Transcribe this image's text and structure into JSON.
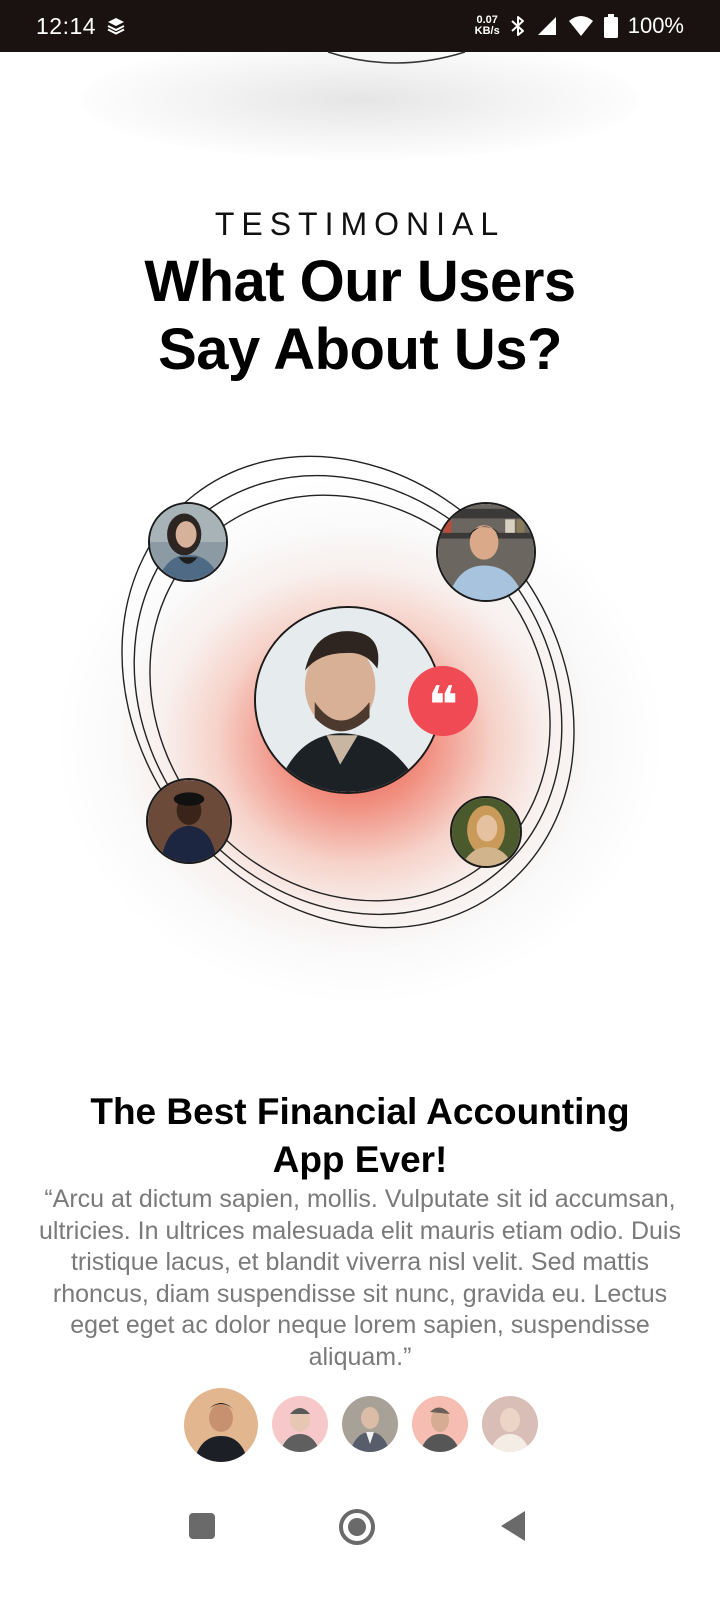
{
  "status_bar": {
    "time": "12:14",
    "net_speed_value": "0.07",
    "net_speed_unit": "KB/s",
    "battery": "100%",
    "icons": [
      "layers-icon",
      "bluetooth-icon",
      "signal-icon",
      "wifi-icon",
      "battery-icon"
    ]
  },
  "section": {
    "eyebrow": "TESTIMONIAL",
    "headline_line1": "What Our Users",
    "headline_line2": "Say About Us?"
  },
  "featured": {
    "quote_mark": "❝",
    "avatars": [
      "user-avatar-woman-denim",
      "user-avatar-man-bookshelf",
      "user-avatar-man-beret",
      "user-avatar-woman-blonde",
      "featured-user-man-beard"
    ]
  },
  "review": {
    "title_line1": "The Best Financial Accounting",
    "title_line2": "App Ever!",
    "text": "“Arcu at dictum sapien, mollis. Vulputate sit id accumsan, ultricies. In ultrices malesuada elit mauris etiam odio. Duis tristique lacus, et blandit viverra nisl velit. Sed mattis rhoncus, diam suspendisse sit nunc, gravida eu. Lectus eget eget ac dolor neque lorem sapien, suspendisse aliquam.”"
  },
  "thumbnails": {
    "active_index": 0,
    "count": 5
  },
  "colors": {
    "accent": "#f04a55",
    "status_bar_bg": "#1a1210",
    "body_text": "#7a7a7a"
  },
  "nav": {
    "icons": [
      "recents-square-icon",
      "home-circle-icon",
      "back-triangle-icon"
    ]
  }
}
